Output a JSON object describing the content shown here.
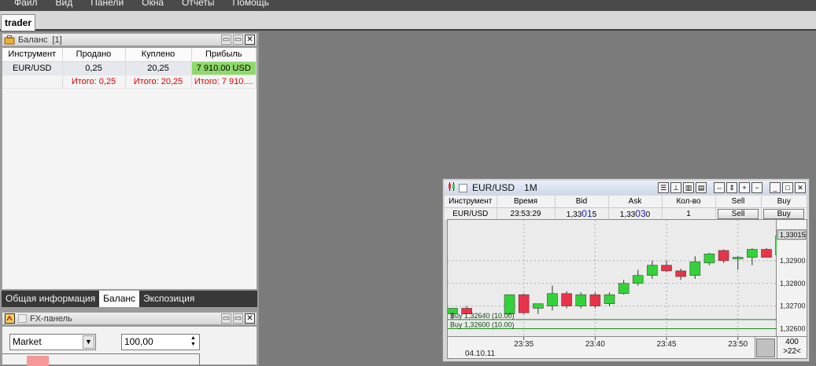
{
  "menu": [
    "Файл",
    "Вид",
    "Панели",
    "Окна",
    "Отчеты",
    "Помощь"
  ],
  "workspace_tab": "trader",
  "balance_panel": {
    "title": "Баланс",
    "count": "[1]",
    "columns": [
      "Инструмент",
      "Продано",
      "Куплено",
      "Прибыль"
    ],
    "row": {
      "instrument": "EUR/USD",
      "sold": "0,25",
      "bought": "20,25",
      "profit": "7 910.00 USD"
    },
    "totals": {
      "sold": "Итого: 0,25",
      "bought": "Итого: 20,25",
      "profit": "Итого: 7 910...."
    },
    "tabs": [
      "Общая информация",
      "Баланс",
      "Экспозиция"
    ],
    "active_tab": "Баланс"
  },
  "fx_panel": {
    "title": "FX-панель",
    "order_type": "Market",
    "quantity": "100,00"
  },
  "chart_window": {
    "symbol": "EUR/USD",
    "timeframe": "1M",
    "columns": [
      "Инструмент",
      "Время",
      "Bid",
      "Ask",
      "Кол-во",
      "Sell",
      "Buy"
    ],
    "quote": {
      "instrument": "EUR/USD",
      "time": "23:53:29",
      "bid_prefix": "1,33",
      "bid_big": "01",
      "bid_suffix": "5",
      "ask_prefix": "1,33",
      "ask_big": "03",
      "ask_suffix": "0",
      "qty": "1",
      "sell_label": "Sell",
      "buy_label": "Buy"
    },
    "orders": [
      "Buy 1,32640 (10.00)",
      "Buy 1,32600 (10.00)"
    ],
    "current_price_label": "1,33015",
    "zoom_value": "400",
    "zoom_label": ">22<",
    "date_label": "04.10.11"
  },
  "chart_data": {
    "type": "candlestick",
    "title": "",
    "y_ticks": [
      1.326,
      1.327,
      1.328,
      1.329
    ],
    "y_tick_labels": [
      "1,32600",
      "1,32700",
      "1,32800",
      "1,32900"
    ],
    "ylim": [
      1.3256,
      1.3308
    ],
    "x_ticks": [
      "23:35",
      "23:40",
      "23:45",
      "23:50"
    ],
    "x_tick_minutes": [
      35,
      40,
      45,
      50
    ],
    "xlim": [
      30.0,
      52.0
    ],
    "order_levels": [
      1.3264,
      1.326
    ],
    "current_price": 1.33015,
    "grid": true,
    "candles": [
      {
        "t": 30.0,
        "o": 1.32665,
        "h": 1.3269,
        "l": 1.3264,
        "c": 1.3269
      },
      {
        "t": 31.0,
        "o": 1.3269,
        "h": 1.327,
        "l": 1.32665,
        "c": 1.32665
      },
      {
        "t": 34.0,
        "o": 1.32665,
        "h": 1.3275,
        "l": 1.3266,
        "c": 1.3275
      },
      {
        "t": 35.0,
        "o": 1.3275,
        "h": 1.32755,
        "l": 1.32665,
        "c": 1.3267
      },
      {
        "t": 36.0,
        "o": 1.3269,
        "h": 1.32705,
        "l": 1.32665,
        "c": 1.3271
      },
      {
        "t": 37.0,
        "o": 1.327,
        "h": 1.3279,
        "l": 1.3268,
        "c": 1.32755
      },
      {
        "t": 38.0,
        "o": 1.32755,
        "h": 1.32765,
        "l": 1.3269,
        "c": 1.327
      },
      {
        "t": 39.0,
        "o": 1.327,
        "h": 1.3276,
        "l": 1.3269,
        "c": 1.3275
      },
      {
        "t": 40.0,
        "o": 1.3275,
        "h": 1.3276,
        "l": 1.3269,
        "c": 1.327
      },
      {
        "t": 41.0,
        "o": 1.3271,
        "h": 1.3276,
        "l": 1.327,
        "c": 1.3275
      },
      {
        "t": 42.0,
        "o": 1.32755,
        "h": 1.32815,
        "l": 1.3275,
        "c": 1.328
      },
      {
        "t": 43.0,
        "o": 1.328,
        "h": 1.3286,
        "l": 1.3279,
        "c": 1.32835
      },
      {
        "t": 44.0,
        "o": 1.32835,
        "h": 1.329,
        "l": 1.3282,
        "c": 1.3288
      },
      {
        "t": 45.0,
        "o": 1.3288,
        "h": 1.329,
        "l": 1.3285,
        "c": 1.32855
      },
      {
        "t": 46.0,
        "o": 1.32855,
        "h": 1.32865,
        "l": 1.32815,
        "c": 1.3283
      },
      {
        "t": 47.0,
        "o": 1.32835,
        "h": 1.3292,
        "l": 1.3282,
        "c": 1.32895
      },
      {
        "t": 48.0,
        "o": 1.3289,
        "h": 1.32935,
        "l": 1.3288,
        "c": 1.3293
      },
      {
        "t": 49.0,
        "o": 1.32945,
        "h": 1.3295,
        "l": 1.3289,
        "c": 1.329
      },
      {
        "t": 50.0,
        "o": 1.3291,
        "h": 1.3292,
        "l": 1.3286,
        "c": 1.32915
      },
      {
        "t": 51.0,
        "o": 1.32915,
        "h": 1.32955,
        "l": 1.3288,
        "c": 1.3295
      },
      {
        "t": 52.0,
        "o": 1.3295,
        "h": 1.32955,
        "l": 1.32915,
        "c": 1.32915
      },
      {
        "t": 53.0,
        "o": 1.32925,
        "h": 1.3302,
        "l": 1.3292,
        "c": 1.3301
      }
    ],
    "colors": {
      "up": "#34d23a",
      "down": "#e8334a",
      "order_line": "#1c8a1c",
      "grid": "#b0b0b0"
    }
  }
}
